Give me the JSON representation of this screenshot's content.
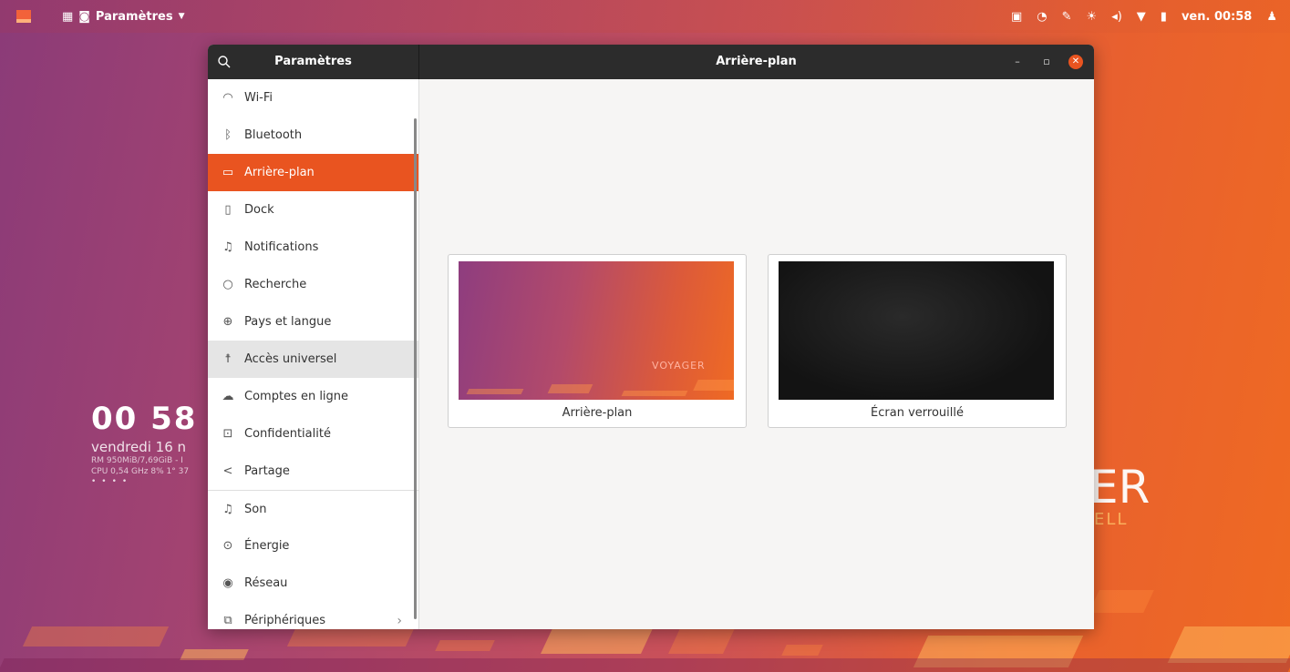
{
  "topbar": {
    "app_name": "Paramètres",
    "clock": "ven. 00:58"
  },
  "desktop": {
    "conky_time": "00 58",
    "conky_date": "vendredi 16 n",
    "conky_ram": "RM 950MiB/7,69GiB - I",
    "conky_cpu": "CPU 0,54 GHz 8% 1° 37",
    "watermark": "ER",
    "watermark_sub": "ELL"
  },
  "window": {
    "sidebar_title": "Paramètres",
    "title": "Arrière-plan"
  },
  "sidebar": {
    "items": [
      {
        "label": "Wi-Fi",
        "icon": "wifi-icon"
      },
      {
        "label": "Bluetooth",
        "icon": "bluetooth-icon"
      },
      {
        "label": "Arrière-plan",
        "icon": "background-icon"
      },
      {
        "label": "Dock",
        "icon": "dock-icon"
      },
      {
        "label": "Notifications",
        "icon": "bell-icon"
      },
      {
        "label": "Recherche",
        "icon": "search-icon"
      },
      {
        "label": "Pays et langue",
        "icon": "globe-icon"
      },
      {
        "label": "Accès universel",
        "icon": "accessibility-icon"
      },
      {
        "label": "Comptes en ligne",
        "icon": "cloud-icon"
      },
      {
        "label": "Confidentialité",
        "icon": "lock-icon"
      },
      {
        "label": "Partage",
        "icon": "share-icon"
      },
      {
        "label": "Son",
        "icon": "music-note-icon"
      },
      {
        "label": "Énergie",
        "icon": "power-icon"
      },
      {
        "label": "Réseau",
        "icon": "network-icon"
      },
      {
        "label": "Périphériques",
        "icon": "devices-icon"
      }
    ]
  },
  "content": {
    "cards": [
      {
        "label": "Arrière-plan",
        "thumb_text": "VOYAGER"
      },
      {
        "label": "Écran verrouillé"
      }
    ]
  },
  "colors": {
    "accent": "#e95420",
    "headerbar": "#2c2c2c"
  }
}
